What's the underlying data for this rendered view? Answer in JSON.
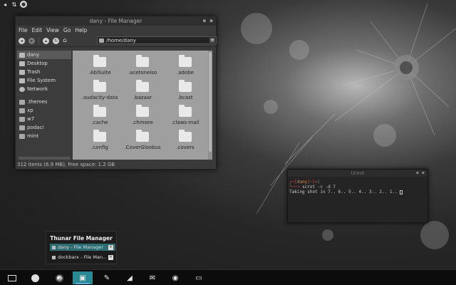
{
  "tray": {
    "icons": [
      "volume-icon",
      "network-icon",
      "user-icon"
    ]
  },
  "file_manager": {
    "title": "dany - File Manager",
    "menu": [
      "File",
      "Edit",
      "View",
      "Go",
      "Help"
    ],
    "path": "/home/dany",
    "sidebar": {
      "home": "dany",
      "places": [
        "Desktop",
        "Trash",
        "File System",
        "Network"
      ],
      "bookmarks": [
        ".themes",
        "xp",
        "w7",
        "podaci",
        "mint"
      ]
    },
    "files": [
      ".AbiSuite",
      ".acetoneiso",
      ".adobe",
      ".audacity-data",
      ".bazaar",
      ".bcast",
      ".cache",
      ".chmsee",
      ".claws-mail",
      ".config",
      ".CoverGloobus",
      ".covers"
    ],
    "status": "312 items (6.9 MB), Free space: 1.2 GB"
  },
  "terminal": {
    "title": "Urxvt",
    "prompt_user": "dany",
    "prompt_suffix": "~",
    "command": "scrot -c -d 7",
    "output": "Taking shot in 7.. 6.. 5.. 4.. 3.. 2.. 1.."
  },
  "popup": {
    "title": "Thunar File Manager",
    "items": [
      "dany - File Manager",
      "dockbarx - File Man..."
    ]
  },
  "dock": {
    "items": [
      "terminal-icon",
      "firefox-icon",
      "chrome-icon",
      "file-manager-icon",
      "editor-icon",
      "shark-icon",
      "mail-icon",
      "update-icon",
      "display-icon"
    ]
  },
  "colors": {
    "accent": "#2a8a94",
    "prompt": "#e08a33"
  }
}
